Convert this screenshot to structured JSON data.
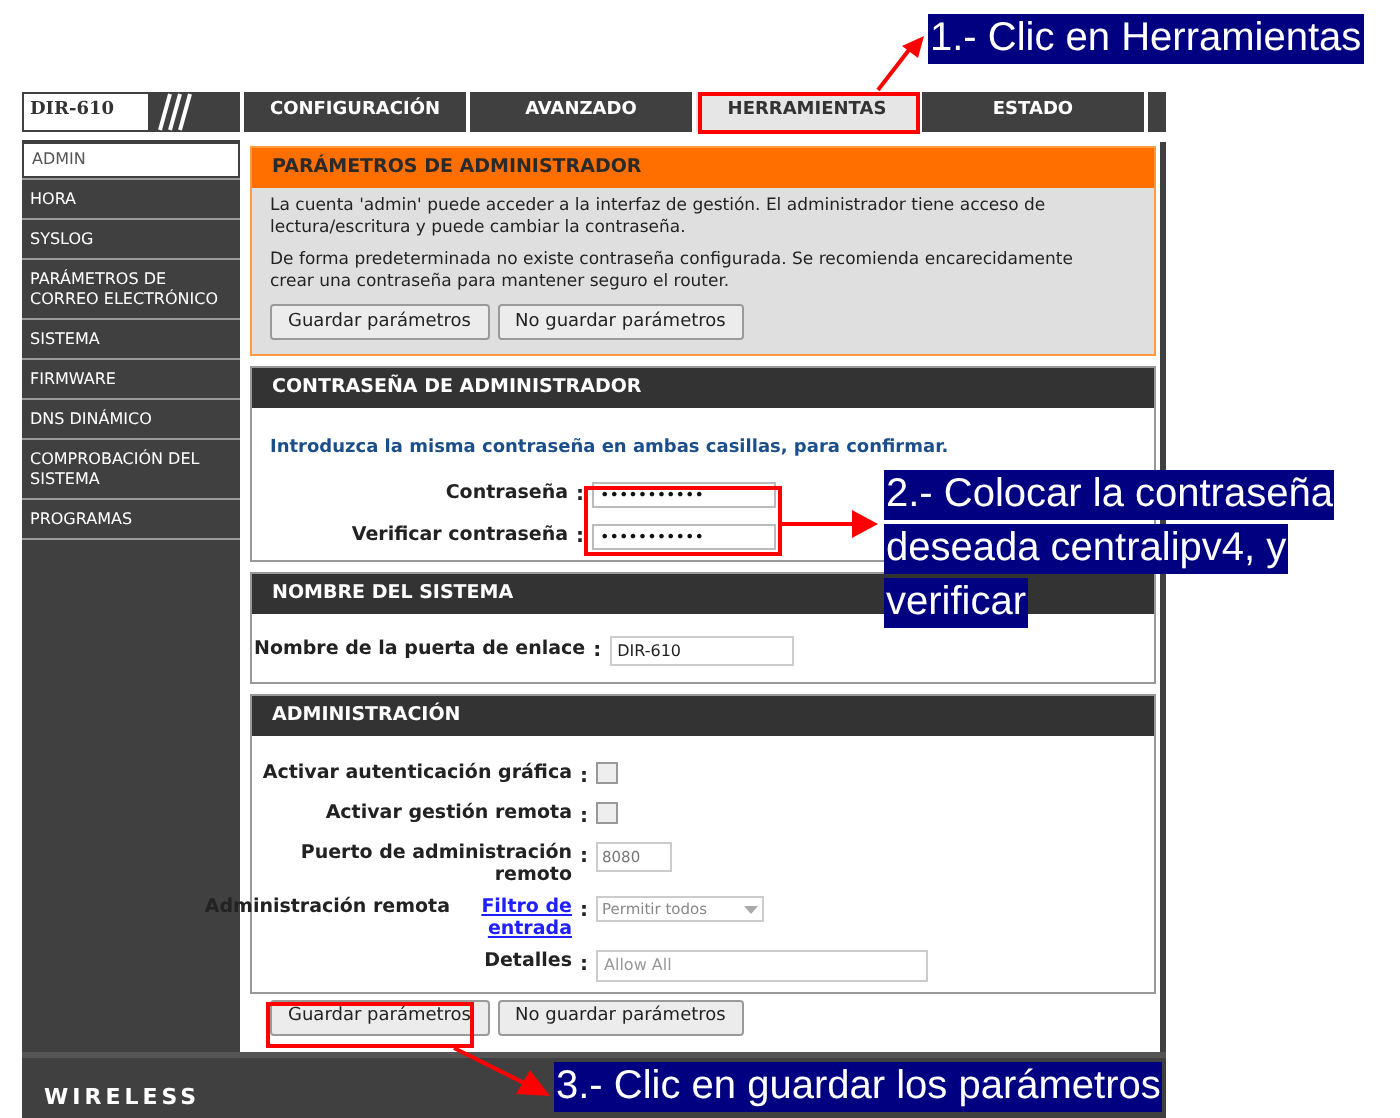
{
  "header": {
    "logo": "DIR-610",
    "tabs": [
      {
        "label": "CONFIGURACIÓN",
        "selected": false
      },
      {
        "label": "AVANZADO",
        "selected": false
      },
      {
        "label": "HERRAMIENTAS",
        "selected": true
      },
      {
        "label": "ESTADO",
        "selected": false
      }
    ]
  },
  "sidebar": {
    "items": [
      {
        "label": "ADMIN",
        "selected": true
      },
      {
        "label": "HORA",
        "selected": false
      },
      {
        "label": "SYSLOG",
        "selected": false
      },
      {
        "label": "PARÁMETROS DE CORREO ELECTRÓNICO",
        "selected": false
      },
      {
        "label": "SISTEMA",
        "selected": false
      },
      {
        "label": "FIRMWARE",
        "selected": false
      },
      {
        "label": "DNS DINÁMICO",
        "selected": false
      },
      {
        "label": "COMPROBACIÓN DEL SISTEMA",
        "selected": false
      },
      {
        "label": "PROGRAMAS",
        "selected": false
      }
    ]
  },
  "admin_params": {
    "title": "PARÁMETROS DE ADMINISTRADOR",
    "paragraphs": [
      "La cuenta 'admin' puede acceder a la interfaz de gestión. El administrador tiene acceso de lectura/escritura y puede cambiar la contraseña.",
      "De forma predeterminada no existe contraseña configurada. Se recomienda encarecidamente crear una contraseña para mantener seguro el router."
    ],
    "buttons": [
      "Guardar parámetros",
      "No guardar parámetros"
    ]
  },
  "admin_password": {
    "title": "CONTRASEÑA DE ADMINISTRADOR",
    "instruction": "Introduzca la misma contraseña en ambas casillas, para confirmar.",
    "fields": [
      {
        "label": "Contraseña",
        "colon": ":",
        "value": "•••••••••••"
      },
      {
        "label": "Verificar contraseña",
        "colon": ":",
        "value": "•••••••••••"
      }
    ]
  },
  "system_name": {
    "title": "NOMBRE DEL SISTEMA",
    "label": "Nombre de la puerta de enlace",
    "colon": ":",
    "value": "DIR-610"
  },
  "administration": {
    "title": "ADMINISTRACIÓN",
    "fields": [
      {
        "kind": "checkbox",
        "label": "Activar autenticación gráfica",
        "colon": ":",
        "checked": false
      },
      {
        "kind": "checkbox",
        "label": "Activar gestión remota",
        "colon": ":",
        "checked": false
      },
      {
        "kind": "text",
        "label": "Puerto de administración remoto",
        "colon": ":",
        "value": "8080"
      },
      {
        "kind": "select",
        "label": "Administración remota",
        "link": "Filtro de entrada",
        "colon": ":",
        "value": "Permitir todos"
      },
      {
        "kind": "wide_text",
        "label": "Detalles",
        "colon": ":",
        "value": "Allow All"
      }
    ]
  },
  "bottom_buttons": [
    "Guardar parámetros",
    "No guardar parámetros"
  ],
  "footer": {
    "brand": "WIRELESS"
  },
  "annotations": [
    {
      "lines": [
        "1.- Clic en Herramientas"
      ]
    },
    {
      "lines": [
        "2.- Colocar la contraseña",
        "deseada centralipv4, y",
        "verificar"
      ]
    },
    {
      "lines": [
        "3.- Clic en guardar los parámetros"
      ]
    }
  ]
}
